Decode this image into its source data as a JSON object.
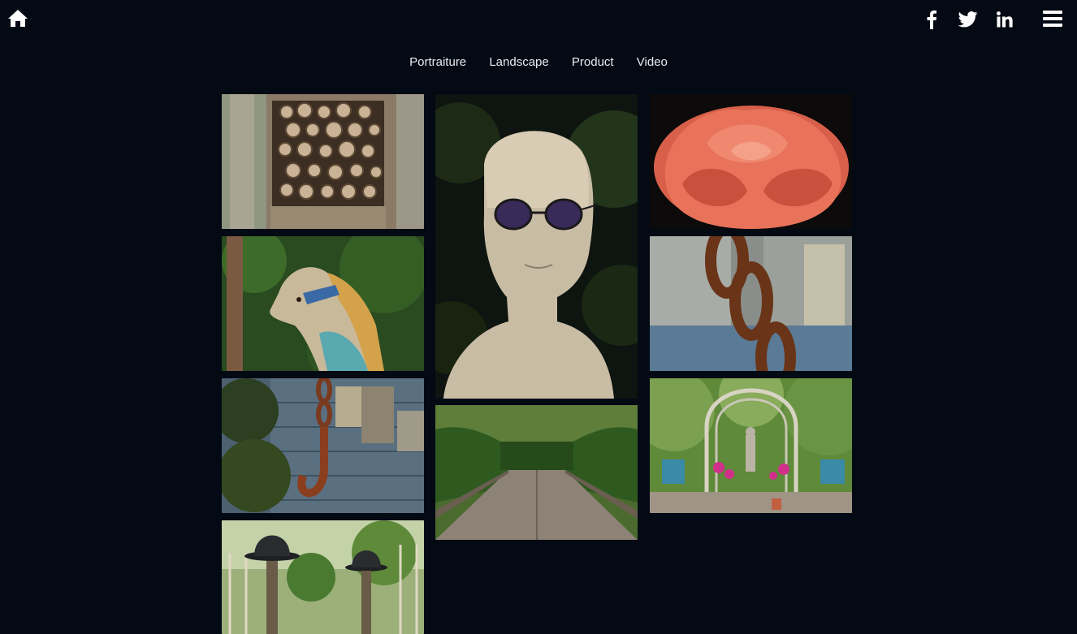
{
  "header": {
    "home_icon": "home-icon",
    "social_icons": [
      "facebook-icon",
      "twitter-icon",
      "linkedin-icon"
    ],
    "menu_icon": "hamburger-menu-icon"
  },
  "nav": {
    "items": [
      {
        "label": "Portraiture"
      },
      {
        "label": "Landscape"
      },
      {
        "label": "Product"
      },
      {
        "label": "Video"
      }
    ]
  },
  "theme": {
    "background": "#040a14",
    "text": "#e8ecf1",
    "icon": "#ffffff"
  },
  "gallery": {
    "tiles": [
      {
        "subject": "bee-hotel"
      },
      {
        "subject": "carousel-horse"
      },
      {
        "subject": "rusty-hook-chain"
      },
      {
        "subject": "hats-on-posts"
      },
      {
        "subject": "mannequin-head-sunglasses"
      },
      {
        "subject": "garden-path"
      },
      {
        "subject": "pink-rose"
      },
      {
        "subject": "rusty-chain-link"
      },
      {
        "subject": "garden-arch"
      }
    ]
  }
}
